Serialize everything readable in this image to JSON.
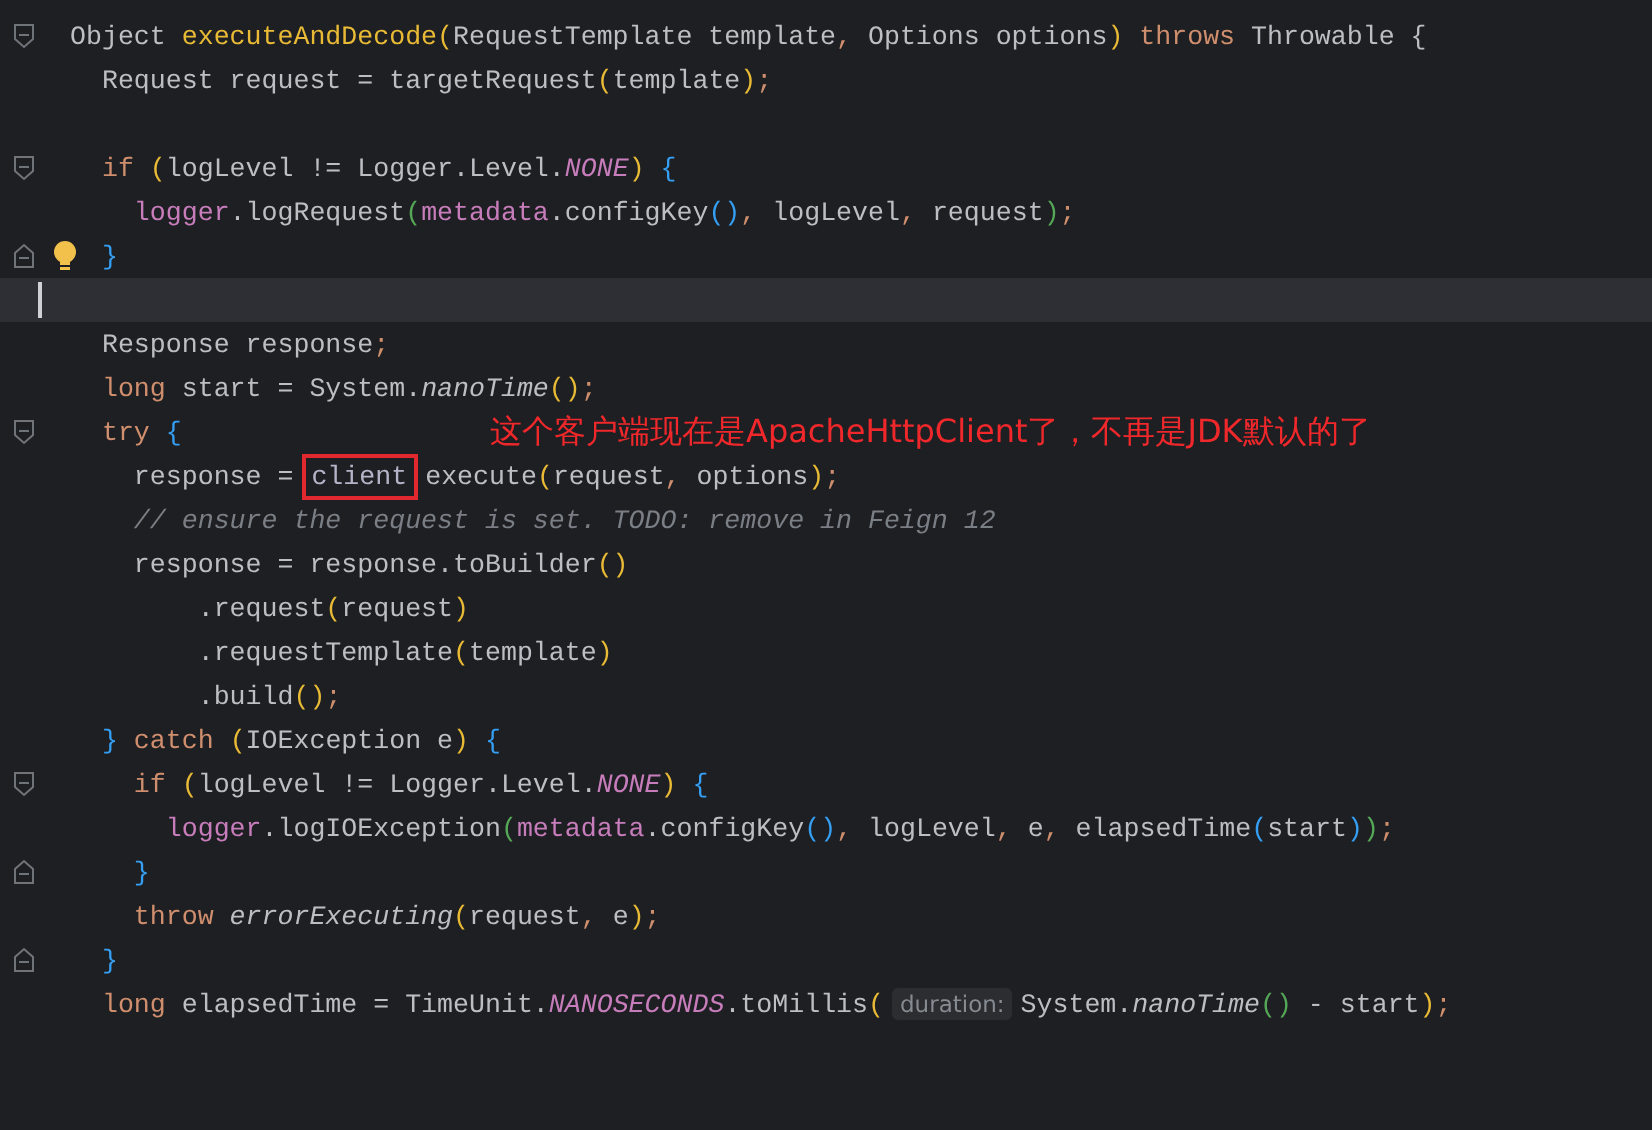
{
  "editor": {
    "lines": [
      {
        "kind": "code",
        "gutter": [
          {
            "kind": "fold-start"
          }
        ],
        "tokens": [
          {
            "text": "Object ",
            "kind": "plain"
          },
          {
            "text": "executeAndDecode",
            "kind": "decl"
          },
          {
            "text": "(",
            "kind": "p1"
          },
          {
            "text": "RequestTemplate template",
            "kind": "plain"
          },
          {
            "text": ",",
            "kind": "punct"
          },
          {
            "text": " Options options",
            "kind": "plain"
          },
          {
            "text": ")",
            "kind": "p1"
          },
          {
            "text": " throws",
            "kind": "keyword"
          },
          {
            "text": " Throwable {",
            "kind": "plain"
          }
        ]
      },
      {
        "kind": "code",
        "tokens": [
          {
            "text": "  Request request = targetRequest",
            "kind": "plain"
          },
          {
            "text": "(",
            "kind": "p1"
          },
          {
            "text": "template",
            "kind": "plain"
          },
          {
            "text": ")",
            "kind": "p1"
          },
          {
            "text": ";",
            "kind": "punct"
          }
        ]
      },
      {
        "kind": "blank"
      },
      {
        "kind": "code",
        "gutter": [
          {
            "kind": "fold-start"
          }
        ],
        "tokens": [
          {
            "text": "  if ",
            "kind": "keyword"
          },
          {
            "text": "(",
            "kind": "p1"
          },
          {
            "text": "logLevel != Logger.Level.",
            "kind": "plain"
          },
          {
            "text": "NONE",
            "kind": "constant"
          },
          {
            "text": ")",
            "kind": "p1"
          },
          {
            "text": " {",
            "kind": "p3"
          }
        ]
      },
      {
        "kind": "code",
        "tokens": [
          {
            "text": "    logger",
            "kind": "field"
          },
          {
            "text": ".logRequest",
            "kind": "plain"
          },
          {
            "text": "(",
            "kind": "p2"
          },
          {
            "text": "metadata",
            "kind": "field"
          },
          {
            "text": ".configKey",
            "kind": "plain"
          },
          {
            "text": "()",
            "kind": "p3"
          },
          {
            "text": ",",
            "kind": "punct"
          },
          {
            "text": " logLevel",
            "kind": "plain"
          },
          {
            "text": ",",
            "kind": "punct"
          },
          {
            "text": " request",
            "kind": "plain"
          },
          {
            "text": ")",
            "kind": "p2"
          },
          {
            "text": ";",
            "kind": "punct"
          }
        ]
      },
      {
        "kind": "code",
        "gutter": [
          {
            "kind": "fold-end"
          },
          {
            "kind": "bulb"
          }
        ],
        "tokens": [
          {
            "text": "  }",
            "kind": "p3"
          }
        ]
      },
      {
        "kind": "caret"
      },
      {
        "kind": "code",
        "tokens": [
          {
            "text": "  Response response",
            "kind": "plain"
          },
          {
            "text": ";",
            "kind": "punct"
          }
        ]
      },
      {
        "kind": "code",
        "tokens": [
          {
            "text": "  long",
            "kind": "keyword"
          },
          {
            "text": " start = System.",
            "kind": "plain"
          },
          {
            "text": "nanoTime",
            "kind": "static"
          },
          {
            "text": "()",
            "kind": "p1"
          },
          {
            "text": ";",
            "kind": "punct"
          }
        ]
      },
      {
        "kind": "code",
        "gutter": [
          {
            "kind": "fold-start"
          }
        ],
        "tokens": [
          {
            "text": "  try",
            "kind": "keyword"
          },
          {
            "text": " {",
            "kind": "p3"
          }
        ]
      },
      {
        "kind": "code",
        "tokens": [
          {
            "text": "    response = ",
            "kind": "plain"
          },
          {
            "text": "client",
            "kind": "boxed"
          },
          {
            "text": "execute",
            "kind": "plain"
          },
          {
            "text": "(",
            "kind": "p1"
          },
          {
            "text": "request",
            "kind": "plain"
          },
          {
            "text": ",",
            "kind": "punct"
          },
          {
            "text": " options",
            "kind": "plain"
          },
          {
            "text": ")",
            "kind": "p1"
          },
          {
            "text": ";",
            "kind": "punct"
          }
        ]
      },
      {
        "kind": "code",
        "tokens": [
          {
            "text": "    // ensure the request is set. TODO: remove in Feign 12",
            "kind": "comment"
          }
        ]
      },
      {
        "kind": "code",
        "tokens": [
          {
            "text": "    response = response.toBuilder",
            "kind": "plain"
          },
          {
            "text": "()",
            "kind": "p1"
          }
        ]
      },
      {
        "kind": "code",
        "tokens": [
          {
            "text": "        .request",
            "kind": "plain"
          },
          {
            "text": "(",
            "kind": "p1"
          },
          {
            "text": "request",
            "kind": "plain"
          },
          {
            "text": ")",
            "kind": "p1"
          }
        ]
      },
      {
        "kind": "code",
        "tokens": [
          {
            "text": "        .requestTemplate",
            "kind": "plain"
          },
          {
            "text": "(",
            "kind": "p1"
          },
          {
            "text": "template",
            "kind": "plain"
          },
          {
            "text": ")",
            "kind": "p1"
          }
        ]
      },
      {
        "kind": "code",
        "tokens": [
          {
            "text": "        .build",
            "kind": "plain"
          },
          {
            "text": "()",
            "kind": "p1"
          },
          {
            "text": ";",
            "kind": "punct"
          }
        ]
      },
      {
        "kind": "code",
        "tokens": [
          {
            "text": "  }",
            "kind": "p3"
          },
          {
            "text": " catch ",
            "kind": "keyword"
          },
          {
            "text": "(",
            "kind": "p1"
          },
          {
            "text": "IOException e",
            "kind": "plain"
          },
          {
            "text": ")",
            "kind": "p1"
          },
          {
            "text": " {",
            "kind": "p3"
          }
        ]
      },
      {
        "kind": "code",
        "gutter": [
          {
            "kind": "fold-start"
          }
        ],
        "tokens": [
          {
            "text": "    if ",
            "kind": "keyword"
          },
          {
            "text": "(",
            "kind": "p1"
          },
          {
            "text": "logLevel != Logger.Level.",
            "kind": "plain"
          },
          {
            "text": "NONE",
            "kind": "constant"
          },
          {
            "text": ")",
            "kind": "p1"
          },
          {
            "text": " {",
            "kind": "p3"
          }
        ]
      },
      {
        "kind": "code",
        "tokens": [
          {
            "text": "      logger",
            "kind": "field"
          },
          {
            "text": ".logIOException",
            "kind": "plain"
          },
          {
            "text": "(",
            "kind": "p2"
          },
          {
            "text": "metadata",
            "kind": "field"
          },
          {
            "text": ".configKey",
            "kind": "plain"
          },
          {
            "text": "()",
            "kind": "p3"
          },
          {
            "text": ",",
            "kind": "punct"
          },
          {
            "text": " logLevel",
            "kind": "plain"
          },
          {
            "text": ",",
            "kind": "punct"
          },
          {
            "text": " e",
            "kind": "plain"
          },
          {
            "text": ",",
            "kind": "punct"
          },
          {
            "text": " elapsedTime",
            "kind": "plain"
          },
          {
            "text": "(",
            "kind": "p3"
          },
          {
            "text": "start",
            "kind": "plain"
          },
          {
            "text": ")",
            "kind": "p3"
          },
          {
            "text": ")",
            "kind": "p2"
          },
          {
            "text": ";",
            "kind": "punct"
          }
        ]
      },
      {
        "kind": "code",
        "gutter": [
          {
            "kind": "fold-end"
          }
        ],
        "tokens": [
          {
            "text": "    }",
            "kind": "p3"
          }
        ]
      },
      {
        "kind": "code",
        "tokens": [
          {
            "text": "    throw ",
            "kind": "keyword"
          },
          {
            "text": "errorExecuting",
            "kind": "static"
          },
          {
            "text": "(",
            "kind": "p1"
          },
          {
            "text": "request",
            "kind": "plain"
          },
          {
            "text": ",",
            "kind": "punct"
          },
          {
            "text": " e",
            "kind": "plain"
          },
          {
            "text": ")",
            "kind": "p1"
          },
          {
            "text": ";",
            "kind": "punct"
          }
        ]
      },
      {
        "kind": "code",
        "gutter": [
          {
            "kind": "fold-end"
          }
        ],
        "tokens": [
          {
            "text": "  }",
            "kind": "p3"
          }
        ]
      },
      {
        "kind": "code",
        "tokens": [
          {
            "text": "  long",
            "kind": "keyword"
          },
          {
            "text": " elapsedTime = TimeUnit.",
            "kind": "plain"
          },
          {
            "text": "NANOSECONDS",
            "kind": "constant"
          },
          {
            "text": ".toMillis",
            "kind": "plain"
          },
          {
            "text": "(",
            "kind": "p1"
          },
          {
            "text": "duration:",
            "kind": "hint"
          },
          {
            "text": "System.",
            "kind": "plain"
          },
          {
            "text": "nanoTime",
            "kind": "static"
          },
          {
            "text": "()",
            "kind": "p2"
          },
          {
            "text": " - start",
            "kind": "plain"
          },
          {
            "text": ")",
            "kind": "p1"
          },
          {
            "text": ";",
            "kind": "punct"
          }
        ]
      }
    ]
  },
  "annotation": {
    "text": "这个客户端现在是ApacheHttpClient了，不再是JDK默认的了"
  }
}
